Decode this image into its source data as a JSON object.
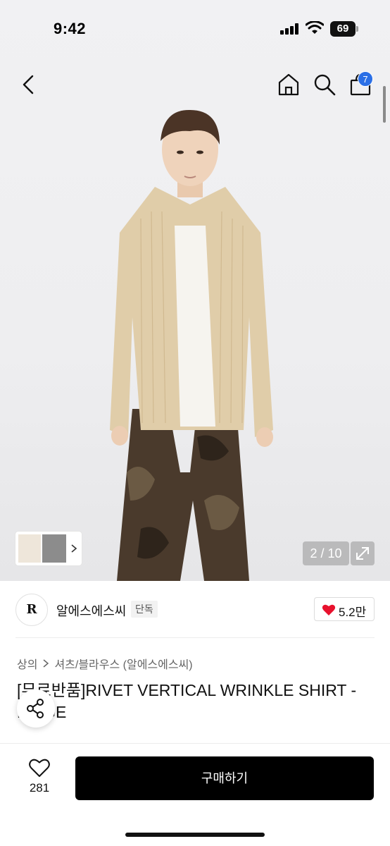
{
  "status_bar": {
    "time": "9:42",
    "battery": "69"
  },
  "nav": {
    "cart_count": "7"
  },
  "gallery": {
    "page_counter": "2 / 10"
  },
  "brand": {
    "name": "알에스에스씨",
    "tag": "단독",
    "likes": "5.2만",
    "logo_text": "R"
  },
  "breadcrumb": {
    "category": "상의",
    "subcategory": "셔츠/블라우스 (알에스에스씨)"
  },
  "product": {
    "title": "[무료반품]RIVET VERTICAL WRINKLE SHIRT - BEIGE"
  },
  "bottom_bar": {
    "wish_count": "281",
    "buy_label": "구매하기"
  },
  "colors": {
    "accent_badge": "#2b6fe6",
    "like_heart": "#e8112d",
    "buy_button": "#000000"
  },
  "icons": [
    "back-icon",
    "home-icon",
    "search-icon",
    "shopping-bag-icon",
    "chevron-right-icon",
    "expand-icon",
    "heart-icon",
    "share-icon"
  ]
}
